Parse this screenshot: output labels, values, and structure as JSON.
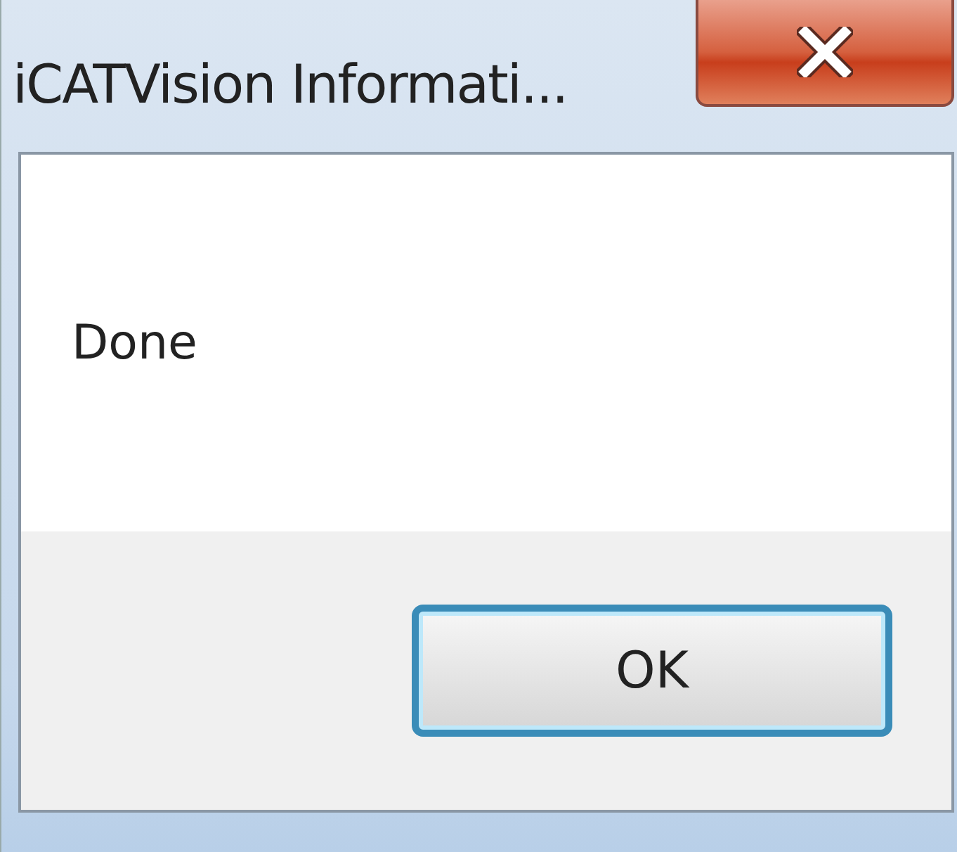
{
  "window": {
    "title": "iCATVision Informati..."
  },
  "message": "Done",
  "buttons": [
    {
      "label": "OK",
      "focused": true
    }
  ]
}
